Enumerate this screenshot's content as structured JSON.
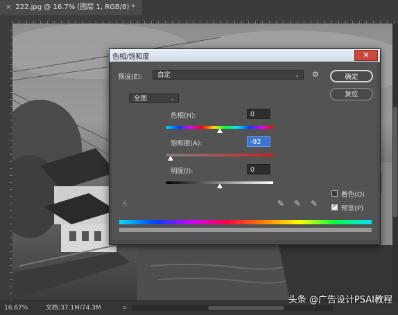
{
  "document": {
    "tab_title": "222.jpg @ 16.7% (图层 1, RGB/8) *",
    "close_glyph": "×"
  },
  "status": {
    "zoom": "16.67%",
    "doc_size": "文档:37.1M/74.3M",
    "arrow": ">"
  },
  "watermark": "头条 @广告设计PSAI教程",
  "dialog": {
    "title": "色相/饱和度",
    "close_glyph": "✕",
    "preset_label": "预设(E):",
    "preset_value": "自定",
    "channel_value": "全图",
    "hue": {
      "label": "色相(H):",
      "value": "0",
      "thumb": 0.5
    },
    "saturation": {
      "label": "饱和度(A):",
      "value": "-92",
      "thumb": 0.04
    },
    "lightness": {
      "label": "明度(I):",
      "value": "0",
      "thumb": 0.5
    },
    "ok_label": "确定",
    "reset_label": "复位",
    "colorize_label": "着色(O)",
    "colorize_checked": false,
    "preview_label": "预览(P)",
    "preview_checked": true,
    "chevron": "⌄",
    "gear_glyph": "⚙"
  }
}
